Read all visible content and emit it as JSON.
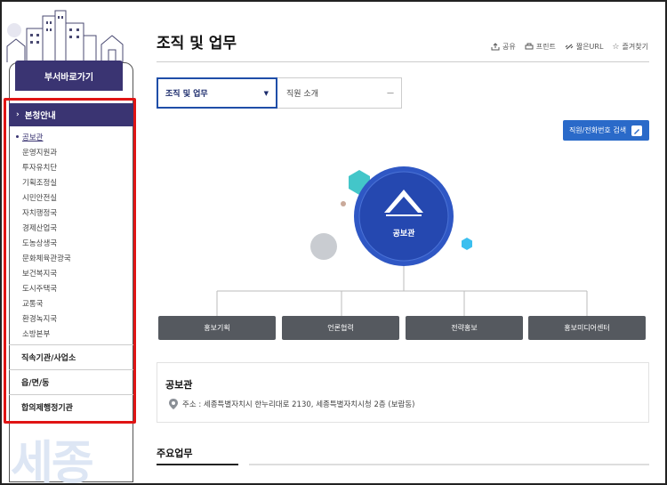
{
  "sidebar": {
    "dept_shortcut": "부서바로가기",
    "section_head": "본청안내",
    "sub_items": [
      {
        "label": "공보관",
        "active": true
      },
      {
        "label": "운영지원과"
      },
      {
        "label": "투자유치단"
      },
      {
        "label": "기획조정실"
      },
      {
        "label": "시민안전실"
      },
      {
        "label": "자치행정국"
      },
      {
        "label": "경제산업국"
      },
      {
        "label": "도농상생국"
      },
      {
        "label": "문화체육관광국"
      },
      {
        "label": "보건복지국"
      },
      {
        "label": "도시주택국"
      },
      {
        "label": "교통국"
      },
      {
        "label": "환경녹지국"
      },
      {
        "label": "소방본부"
      }
    ],
    "other_sections": [
      "직속기관/사업소",
      "읍/면/동",
      "합의제행정기관"
    ],
    "watermark": "세종"
  },
  "header": {
    "title": "조직 및 업무",
    "utils": [
      {
        "label": "공유",
        "icon": "share-icon"
      },
      {
        "label": "프린트",
        "icon": "print-icon"
      },
      {
        "label": "짧은URL",
        "icon": "link-icon"
      },
      {
        "label": "즐겨찾기",
        "icon": "star-icon"
      }
    ]
  },
  "selectors": {
    "primary": {
      "value": "조직 및 업무",
      "indicator": "▼"
    },
    "secondary": {
      "value": "직원 소개",
      "indicator": "—"
    }
  },
  "search_button": {
    "label": "직원/전화번호 검색"
  },
  "org_chart": {
    "root": "공보관",
    "children": [
      "홍보기획",
      "언론협력",
      "전략홍보",
      "홍보미디어센터"
    ]
  },
  "info": {
    "title": "공보관",
    "address": "주소 : 세종특별자치시 한누리대로 2130, 세종특별자치시청 2층 (보람동)"
  },
  "section": {
    "title": "주요업무"
  },
  "colors": {
    "brand": "#3a3472",
    "accent": "#2a6ac9",
    "highlight": "#e01414",
    "node": "#55595f"
  }
}
